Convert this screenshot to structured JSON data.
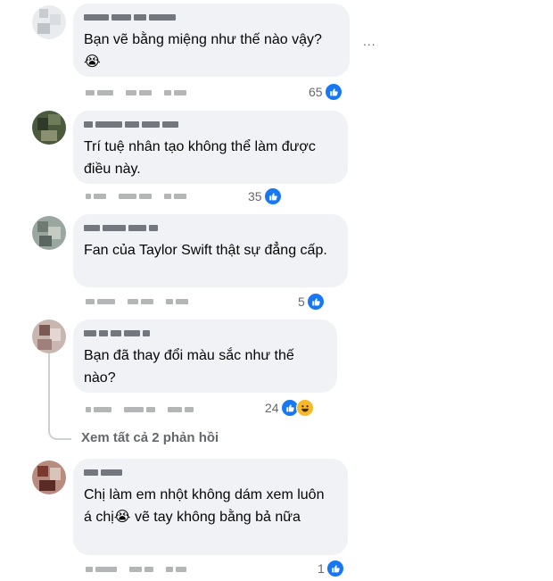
{
  "comments": [
    {
      "text": "Bạn vẽ bằng miệng như thế nào vậy?😭",
      "reaction_count": "65",
      "reactions": [
        "like-icon"
      ]
    },
    {
      "text": "Trí tuệ nhân tạo không thể làm được điều này.",
      "reaction_count": "35",
      "reactions": [
        "like-icon"
      ]
    },
    {
      "text": "Fan của Taylor Swift thật sự đẳng cấp.",
      "reaction_count": "5",
      "reactions": [
        "like-icon"
      ]
    },
    {
      "text": "Bạn đã thay đổi màu sắc như thế nào?",
      "reaction_count": "24",
      "reactions": [
        "like-icon",
        "haha-icon"
      ]
    },
    {
      "text": "Chị làm em nhột không dám xem luôn á chị😭 vẽ tay không bằng bả nữa",
      "reaction_count": "1",
      "reactions": [
        "like-icon"
      ]
    }
  ],
  "more_options": "...",
  "view_replies": "Xem tất cả 2 phản hồi",
  "colors": {
    "like": "#1877f2",
    "haha": "#f7b928",
    "bubble": "#f0f2f5",
    "meta": "#65676b"
  }
}
